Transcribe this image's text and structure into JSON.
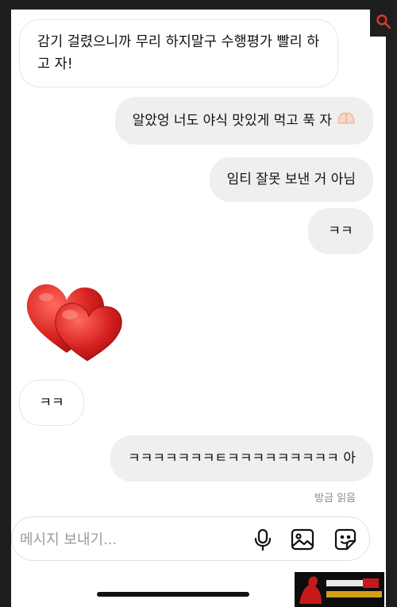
{
  "messages": [
    {
      "dir": "in",
      "text": "감기 걸렸으니까 무리 하지말구 수행평가 빨리 하고 자!"
    },
    {
      "dir": "out",
      "text": "알았엉 너도 야식 맛있게 먹고 푹 자"
    },
    {
      "dir": "out",
      "text": "임티 잘못 보낸 거 아님"
    },
    {
      "dir": "out",
      "text": "ㅋㅋ"
    },
    {
      "dir": "in",
      "sticker": "two-red-hearts"
    },
    {
      "dir": "in",
      "text": "ㅋㅋ"
    },
    {
      "dir": "out",
      "text": "ㅋㅋㅋㅋㅋㅋㅋㅌㅋㅋㅋㅋㅋㅋㅋㅋㅋ 아"
    }
  ],
  "read_receipt": "방금 읽음",
  "composer": {
    "placeholder": "메시지 보내기..."
  },
  "icons": {
    "search": "search-icon",
    "mic": "microphone-icon",
    "gallery": "image-icon",
    "sticker": "sticker-icon"
  },
  "colors": {
    "out_bubble": "#efefef",
    "in_bubble_border": "#e6e6e6",
    "search_accent": "#e0352b",
    "heart": "#d42020"
  }
}
